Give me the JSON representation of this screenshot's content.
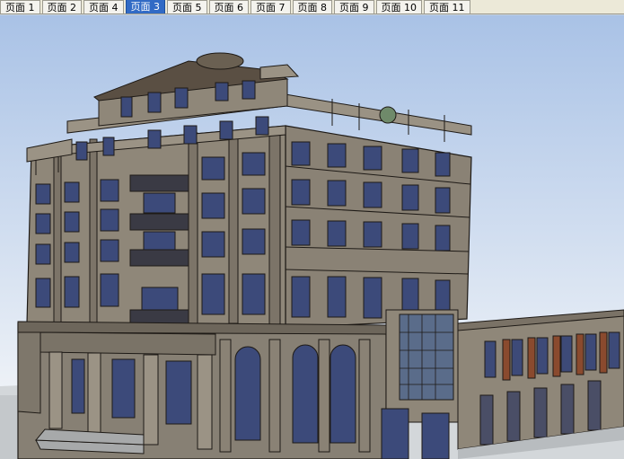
{
  "tabs": [
    {
      "label": "页面 1",
      "active": false
    },
    {
      "label": "页面 2",
      "active": false
    },
    {
      "label": "页面 4",
      "active": false
    },
    {
      "label": "页面 3",
      "active": true
    },
    {
      "label": "页面 5",
      "active": false
    },
    {
      "label": "页面 6",
      "active": false
    },
    {
      "label": "页面 7",
      "active": false
    },
    {
      "label": "页面 8",
      "active": false
    },
    {
      "label": "页面 9",
      "active": false
    },
    {
      "label": "页面 10",
      "active": false
    },
    {
      "label": "页面 11",
      "active": false
    }
  ],
  "colors": {
    "sky_top": "#a9c2e6",
    "sky_bottom": "#e8eef6",
    "ground": "#d2d6d8",
    "facade": "#8f8779",
    "facade_dark": "#736b5f",
    "window": "#3c4a7a",
    "tab_active": "#316ac5"
  }
}
